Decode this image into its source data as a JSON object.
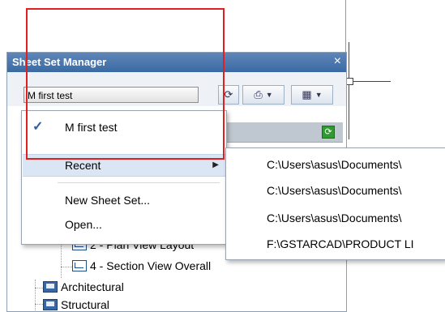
{
  "panel": {
    "title": "Sheet Set Manager",
    "close_label": "×",
    "sheetset_select_value": "M first test"
  },
  "toolbar": {
    "refresh_icon": "refresh-icon",
    "publish_icon": "publish-icon",
    "view_icon": "view-options-icon"
  },
  "context_menu": {
    "current": "M first test",
    "recent": "Recent",
    "new_sheet_set": "New Sheet Set...",
    "open": "Open..."
  },
  "recent_files": [
    "C:\\Users\\asus\\Documents\\",
    "C:\\Users\\asus\\Documents\\",
    "C:\\Users\\asus\\Documents\\",
    "F:\\GSTARCAD\\PRODUCT LI"
  ],
  "tree": {
    "partial_row": "2 - Plan View Layout",
    "section_view": "4 - Section View Overall",
    "architectural": "Architectural",
    "structural": "Structural"
  },
  "colors": {
    "titlebar": "#3a6aa4",
    "annotation_red": "#e02020",
    "menu_highlight": "#dbe6f5"
  }
}
